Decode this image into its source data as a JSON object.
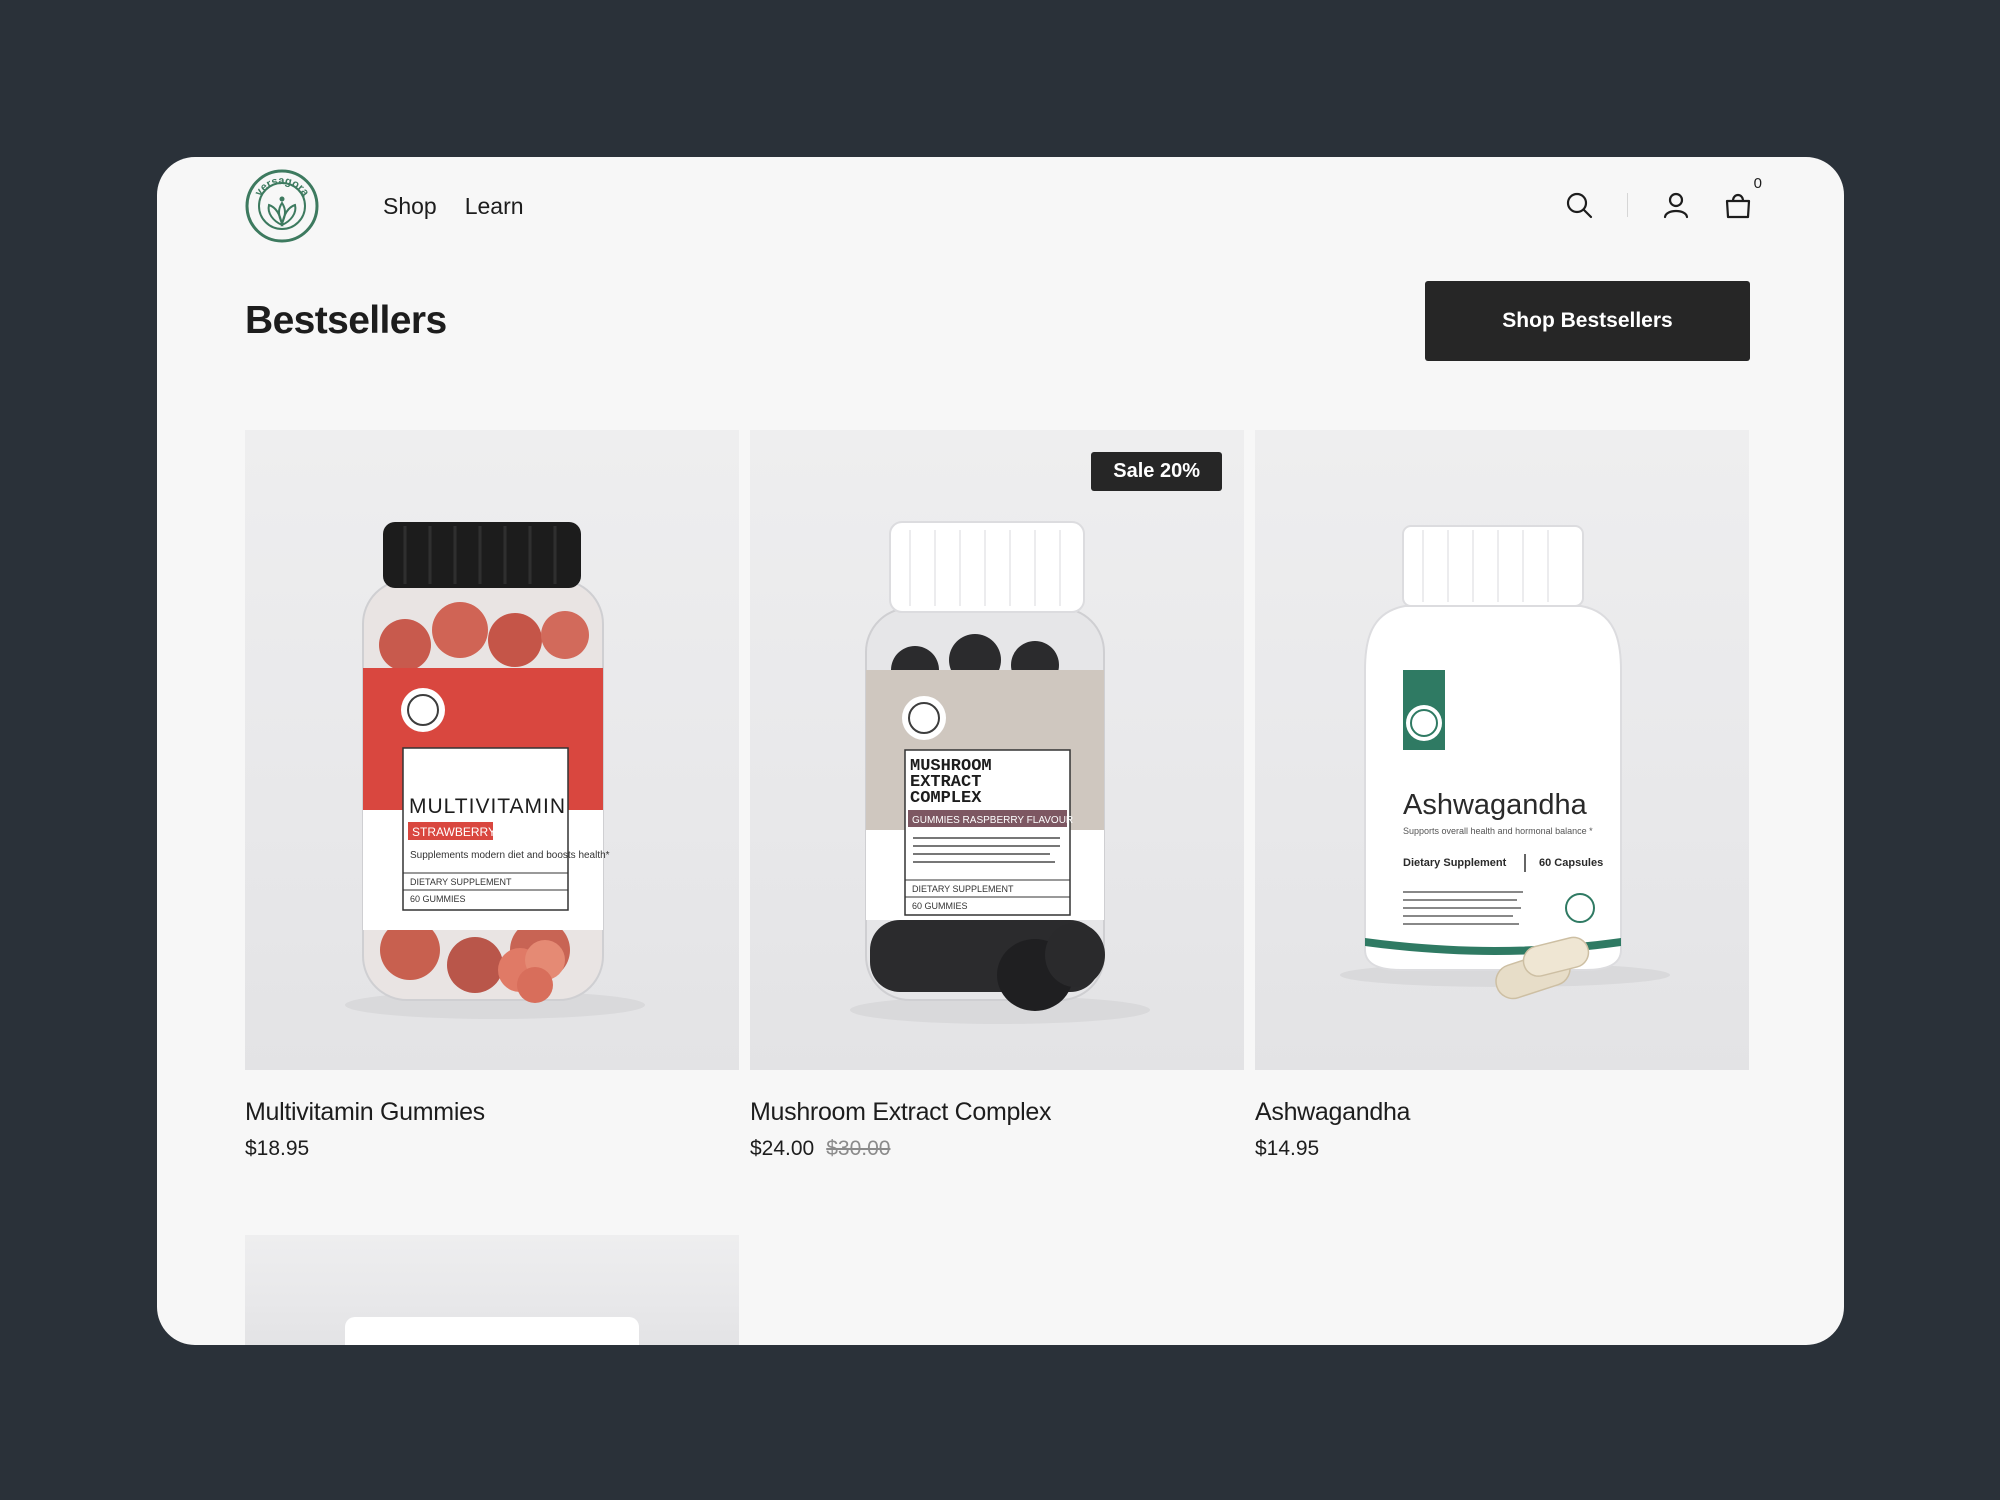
{
  "header": {
    "logo_text": "versagora",
    "nav": [
      "Shop",
      "Learn"
    ],
    "cart_count": "0"
  },
  "section": {
    "title": "Bestsellers",
    "cta_label": "Shop Bestsellers"
  },
  "products": [
    {
      "name": "Multivitamin Gummies",
      "price": "$18.95",
      "old_price": "",
      "badge": "",
      "label_title": "MULTIVITAMIN",
      "label_flavor": "STRAWBERRY",
      "label_desc": "Supplements modern diet and boosts health*",
      "label_type": "DIETARY SUPPLEMENT",
      "label_count": "60 GUMMIES",
      "colors": {
        "label": "#d9473f",
        "cap": "#1c1c1c",
        "gummy": "#d56a5a"
      }
    },
    {
      "name": "Mushroom Extract Complex",
      "price": "$24.00",
      "old_price": "$30.00",
      "badge": "Sale 20%",
      "label_title_1": "MUSHROOM",
      "label_title_2": "EXTRACT",
      "label_title_3": "COMPLEX",
      "label_flavor": "GUMMIES RASPBERRY FLAVOUR",
      "label_type": "DIETARY SUPPLEMENT",
      "label_count": "60 GUMMIES",
      "colors": {
        "label": "#cfc7bf",
        "cap": "#ffffff",
        "gummy": "#2b2b2d",
        "flavor_bar": "#7d5762"
      }
    },
    {
      "name": "Ashwagandha",
      "price": "$14.95",
      "old_price": "",
      "badge": "",
      "label_title": "Ashwagandha",
      "label_sub": "Supports overall health and hormonal balance *",
      "label_type": "Dietary Supplement",
      "label_count": "60 Capsules",
      "colors": {
        "accent": "#2f7a63",
        "bottle": "#ffffff",
        "capsule": "#e7ddc8"
      }
    }
  ],
  "colors": {
    "background": "#2a3139",
    "panel": "#f7f7f7",
    "button": "#262626",
    "brand_green": "#3d7a5f"
  }
}
